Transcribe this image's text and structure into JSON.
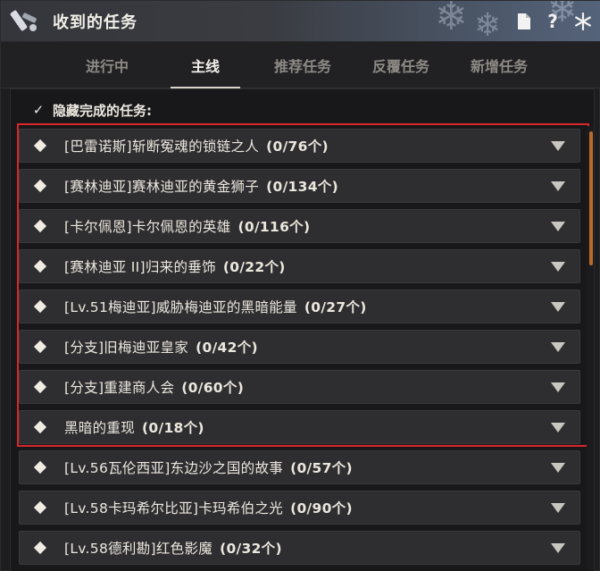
{
  "window": {
    "title": "收到的任务",
    "icons": {
      "app": "quest-scroll-icon",
      "document": "document-icon",
      "help": "?",
      "settings": "snowflake-settings-icon"
    }
  },
  "tabs": [
    {
      "label": "进行中",
      "active": false
    },
    {
      "label": "主线",
      "active": true
    },
    {
      "label": "推荐任务",
      "active": false
    },
    {
      "label": "反覆任务",
      "active": false
    },
    {
      "label": "新增任务",
      "active": false
    }
  ],
  "filter": {
    "label": "隐藏完成的任务:",
    "checked": true,
    "check_glyph": "✓"
  },
  "quests": [
    {
      "name": "[巴雷诺斯]斩断冤魂的锁链之人",
      "count": "(0/76个)"
    },
    {
      "name": "[赛林迪亚]赛林迪亚的黄金狮子",
      "count": "(0/134个)"
    },
    {
      "name": "[卡尔佩恩]卡尔佩恩的英雄",
      "count": "(0/116个)"
    },
    {
      "name": "[赛林迪亚 II]归来的垂饰",
      "count": "(0/22个)"
    },
    {
      "name": "[Lv.51梅迪亚]威胁梅迪亚的黑暗能量",
      "count": "(0/27个)"
    },
    {
      "name": "[分支]旧梅迪亚皇家",
      "count": "(0/42个)"
    },
    {
      "name": "[分支]重建商人会",
      "count": "(0/60个)"
    },
    {
      "name": "黑暗的重现",
      "count": "(0/18个)"
    },
    {
      "name": "[Lv.56瓦伦西亚]东边沙之国的故事",
      "count": "(0/57个)"
    },
    {
      "name": "[Lv.58卡玛希尔比亚]卡玛希伯之光",
      "count": "(0/90个)"
    },
    {
      "name": "[Lv.58德利勘]红色影魔",
      "count": "(0/32个)"
    }
  ],
  "colors": {
    "highlight": "#d8262b",
    "scroll_thumb": "#b86a2d",
    "tab_active": "#f3f0ea",
    "tab_inactive": "#8d8a85"
  }
}
